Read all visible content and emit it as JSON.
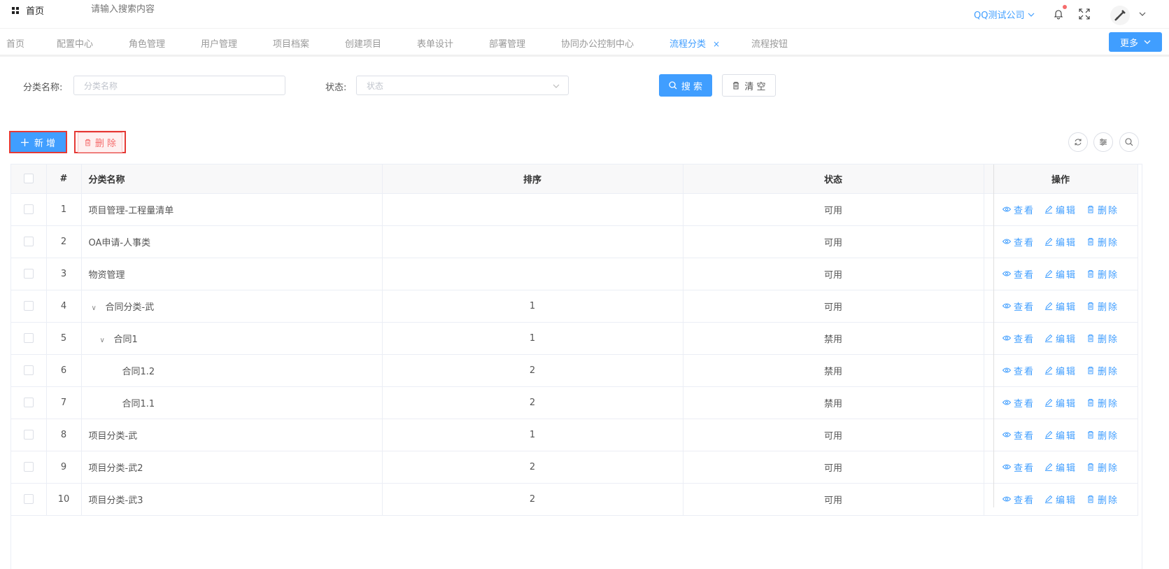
{
  "topbar": {
    "home_label": "首页",
    "search_placeholder": "请输入搜索内容",
    "company": "QQ测试公司"
  },
  "tabs": [
    {
      "label": "首页",
      "active": false
    },
    {
      "label": "配置中心",
      "active": false
    },
    {
      "label": "角色管理",
      "active": false
    },
    {
      "label": "用户管理",
      "active": false
    },
    {
      "label": "项目档案",
      "active": false
    },
    {
      "label": "创建项目",
      "active": false
    },
    {
      "label": "表单设计",
      "active": false
    },
    {
      "label": "部署管理",
      "active": false
    },
    {
      "label": "协同办公控制中心",
      "active": false
    },
    {
      "label": "流程分类",
      "active": true,
      "closable": true
    },
    {
      "label": "流程按钮",
      "active": false
    }
  ],
  "tab_close": "×",
  "more_label": "更多",
  "form": {
    "name_label": "分类名称:",
    "name_placeholder": "分类名称",
    "status_label": "状态:",
    "status_placeholder": "状态",
    "search_label": "搜 索",
    "clear_label": "清 空"
  },
  "toolbar": {
    "add_label": "新 增",
    "delete_label": "删 除"
  },
  "table": {
    "columns": [
      "#",
      "分类名称",
      "排序",
      "状态",
      "操作"
    ],
    "rows": [
      {
        "idx": "1",
        "name": "项目管理-工程量清单",
        "level": 0,
        "expand": false,
        "sort": "",
        "status": "可用"
      },
      {
        "idx": "2",
        "name": "OA申请-人事类",
        "level": 0,
        "expand": false,
        "sort": "",
        "status": "可用"
      },
      {
        "idx": "3",
        "name": "物资管理",
        "level": 0,
        "expand": false,
        "sort": "",
        "status": "可用"
      },
      {
        "idx": "4",
        "name": "合同分类-武",
        "level": 0,
        "expand": true,
        "sort": "1",
        "status": "可用"
      },
      {
        "idx": "5",
        "name": "合同1",
        "level": 1,
        "expand": true,
        "sort": "1",
        "status": "禁用"
      },
      {
        "idx": "6",
        "name": "合同1.2",
        "level": 2,
        "expand": false,
        "sort": "2",
        "status": "禁用"
      },
      {
        "idx": "7",
        "name": "合同1.1",
        "level": 2,
        "expand": false,
        "sort": "2",
        "status": "禁用"
      },
      {
        "idx": "8",
        "name": "项目分类-武",
        "level": 0,
        "expand": false,
        "sort": "1",
        "status": "可用"
      },
      {
        "idx": "9",
        "name": "项目分类-武2",
        "level": 0,
        "expand": false,
        "sort": "2",
        "status": "可用"
      },
      {
        "idx": "10",
        "name": "项目分类-武3",
        "level": 0,
        "expand": false,
        "sort": "2",
        "status": "可用"
      }
    ],
    "ops": {
      "view": "查看",
      "edit": "编辑",
      "delete": "删除"
    }
  },
  "colors": {
    "accent": "#409eff",
    "danger": "#f56c6c",
    "highlight_border": "#e53935"
  },
  "icons": [
    "grid-icon",
    "bell-icon",
    "fullscreen-icon",
    "avatar",
    "search-icon",
    "trash-icon",
    "plus-icon",
    "refresh-icon",
    "filter-icon",
    "eye-icon",
    "edit-icon",
    "chevron-down-icon"
  ]
}
